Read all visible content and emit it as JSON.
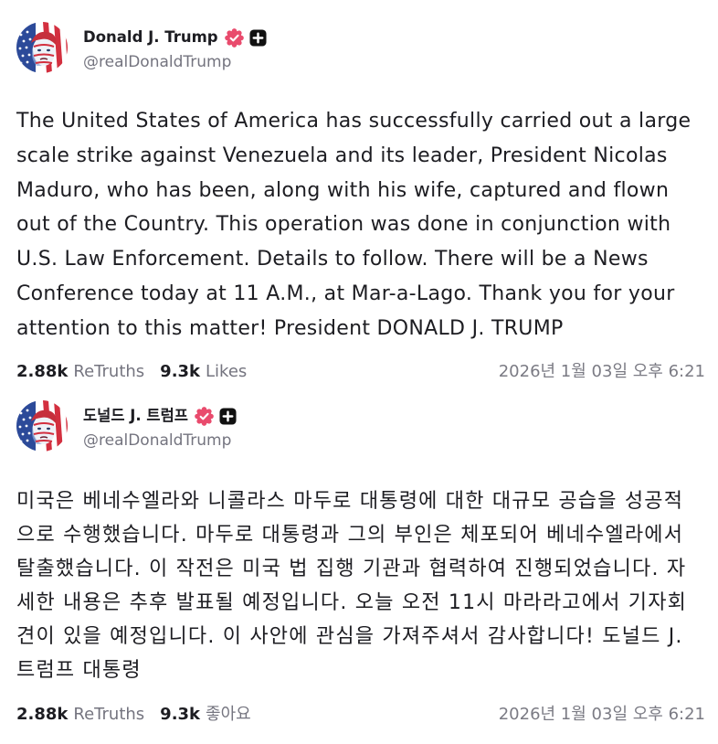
{
  "posts": [
    {
      "author": {
        "name": "Donald J. Trump",
        "handle": "@realDonaldTrump",
        "badges": [
          "verified-badge-icon",
          "plus-badge-icon"
        ]
      },
      "body": "The United States of America has successfully carried out a large scale strike against Venezuela and its leader, President Nicolas Maduro, who has been, along with his wife, captured and flown out of the Country. This operation was done in conjunction with U.S. Law Enforcement. Details to follow. There will be a News Conference today at 11 A.M., at Mar-a-Lago. Thank you for your attention to this matter! President DONALD J. TRUMP",
      "stats": {
        "retruths_count": "2.88k",
        "retruths_label": "ReTruths",
        "likes_count": "9.3k",
        "likes_label": "Likes"
      },
      "timestamp": "2026년 1월 03일 오후 6:21"
    },
    {
      "author": {
        "name": "도널드 J. 트럼프",
        "handle": "@realDonaldTrump",
        "badges": [
          "verified-badge-icon",
          "plus-badge-icon"
        ]
      },
      "body": "미국은 베네수엘라와 니콜라스 마두로 대통령에 대한 대규모 공습을 성공적으로 수행했습니다. 마두로 대통령과 그의 부인은 체포되어 베네수엘라에서 탈출했습니다. 이 작전은 미국 법 집행 기관과 협력하여 진행되었습니다. 자세한 내용은 추후 발표될 예정입니다. 오늘 오전 11시 마라라고에서 기자회견이 있을 예정입니다. 이 사안에 관심을 가져주셔서 감사합니다! 도널드 J. 트럼프 대통령",
      "stats": {
        "retruths_count": "2.88k",
        "retruths_label": "ReTruths",
        "likes_count": "9.3k",
        "likes_label": "좋아요"
      },
      "timestamp": "2026년 1월 03일 오후 6:21"
    }
  ],
  "colors": {
    "verified_badge": "#e94b6d",
    "plus_badge": "#111111",
    "primary_text": "#1d1d22",
    "secondary_text": "#74747f",
    "background": "#ffffff"
  }
}
